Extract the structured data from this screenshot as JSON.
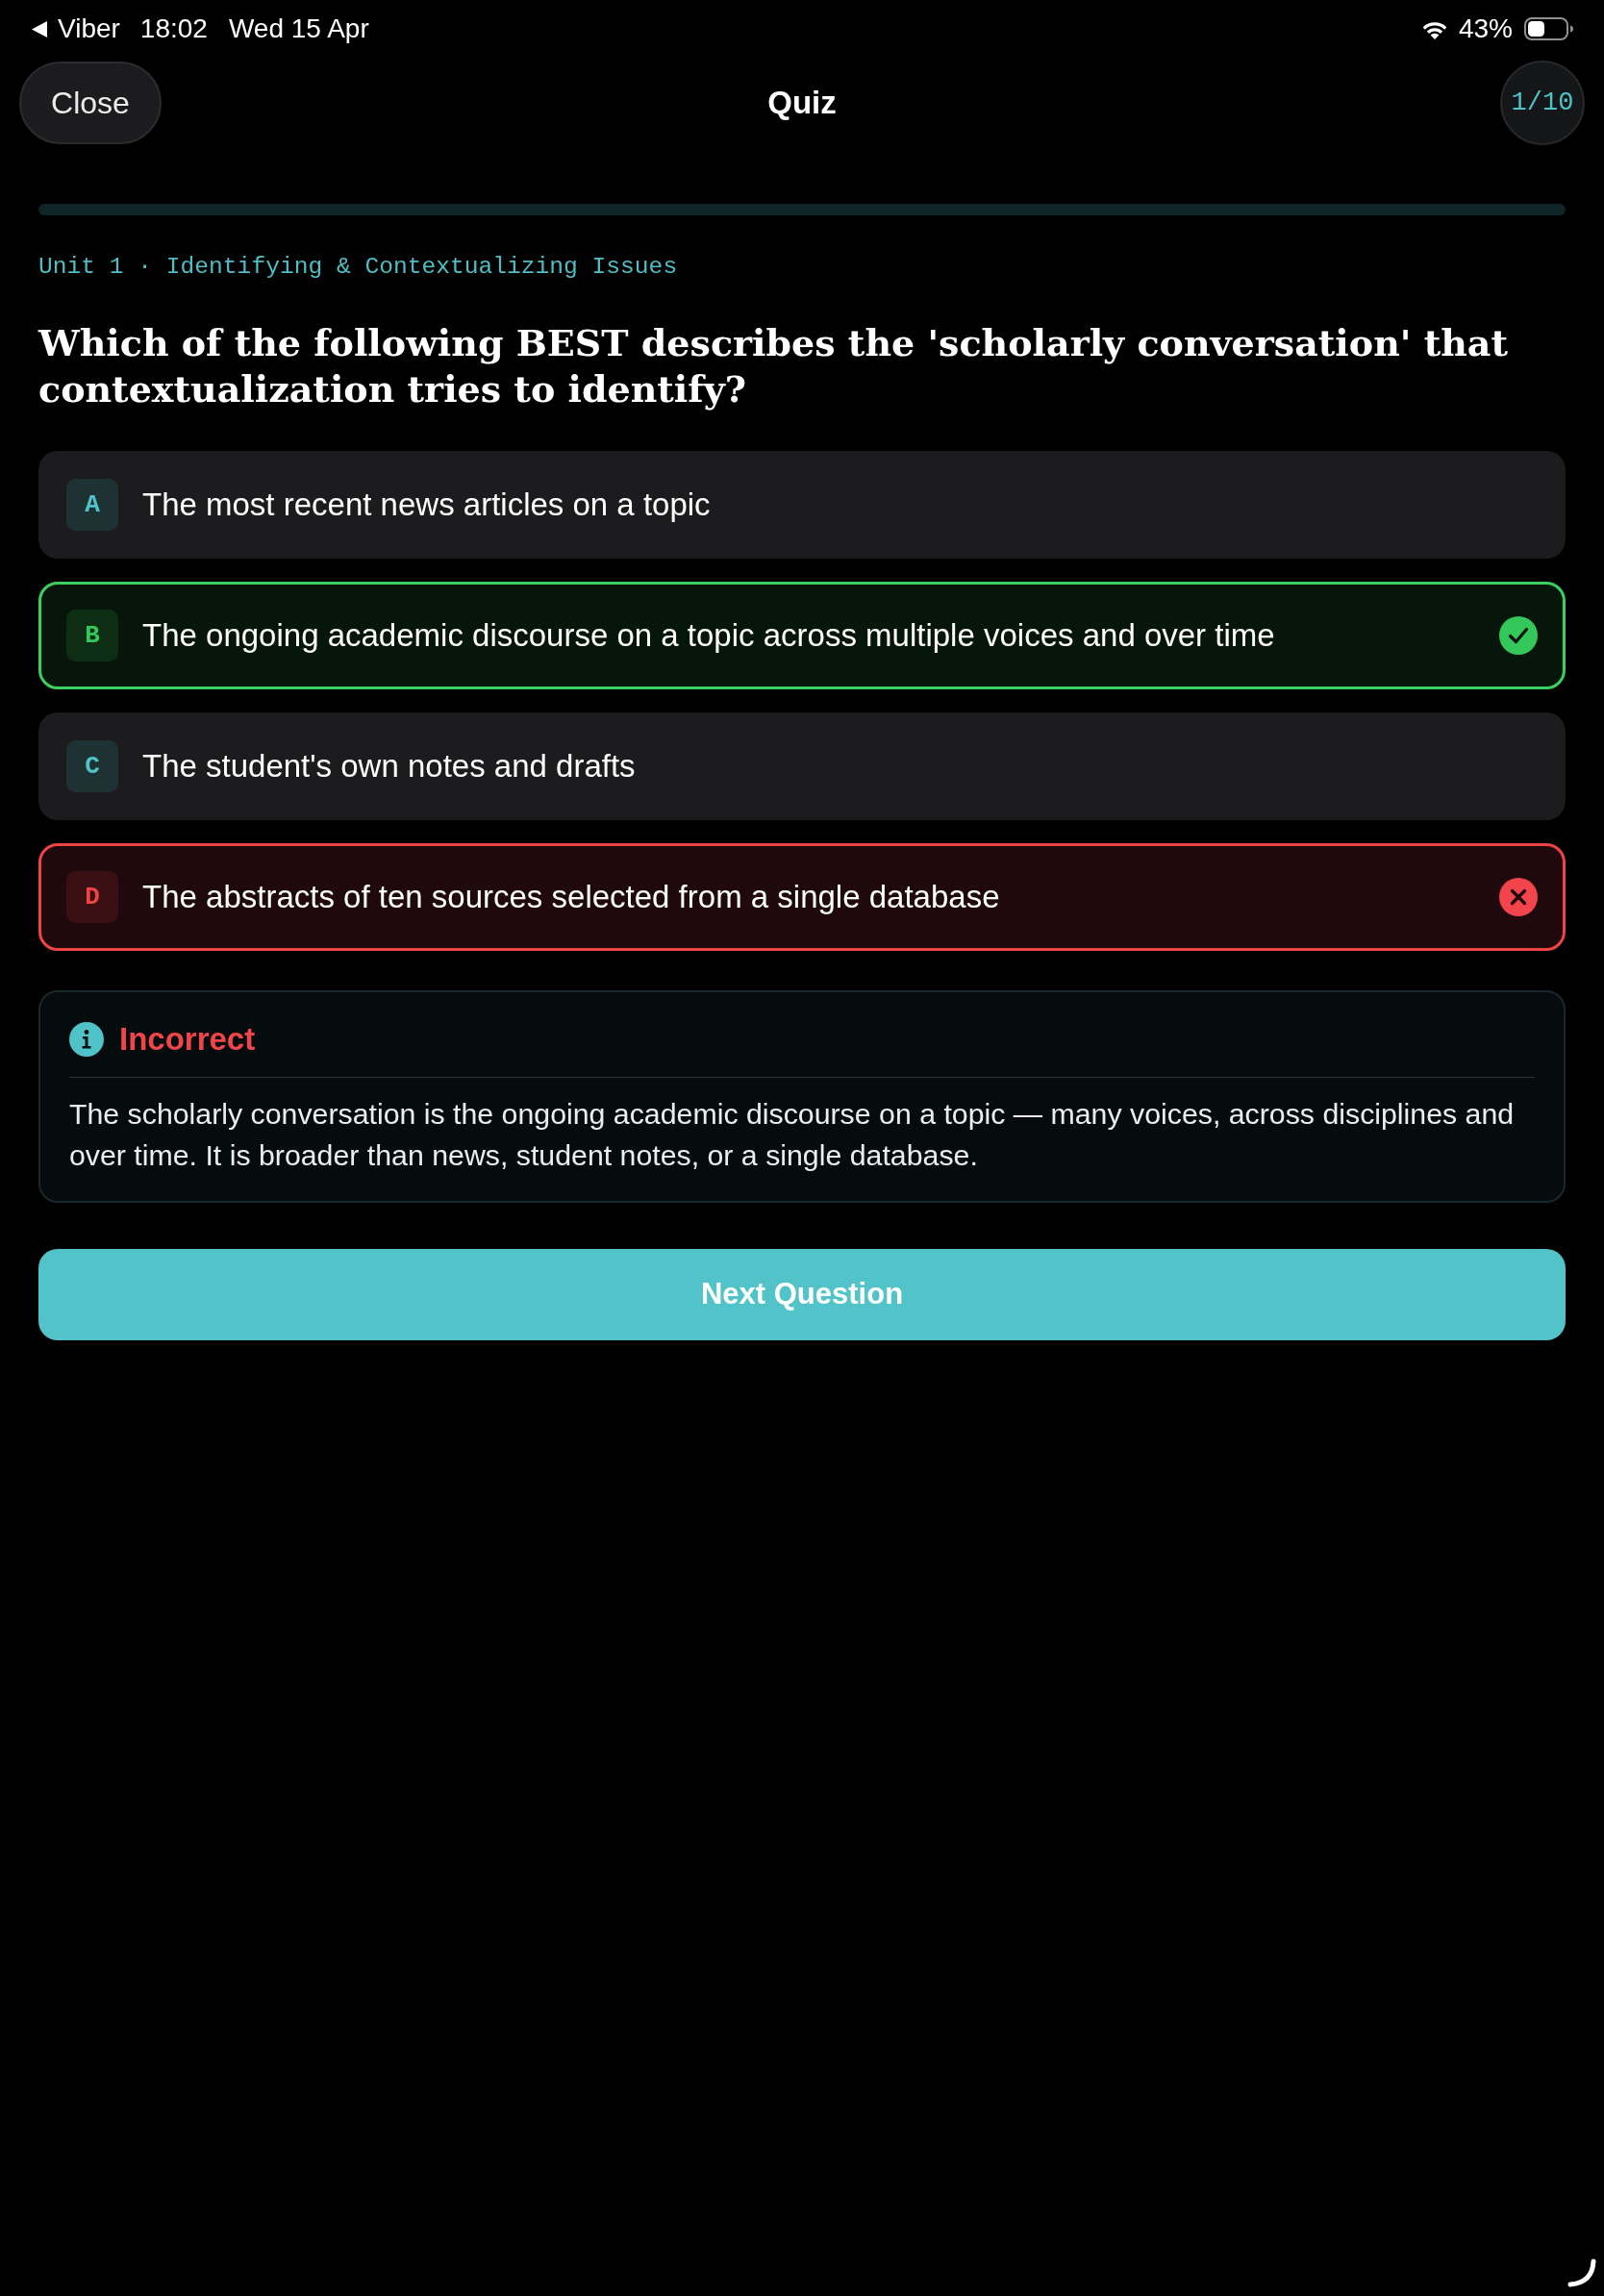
{
  "status_bar": {
    "back_app": "Viber",
    "time": "18:02",
    "date": "Wed 15 Apr",
    "battery": "43%"
  },
  "header": {
    "close_button": "Close",
    "title": "Quiz",
    "counter": "1/10"
  },
  "question": {
    "unit": "Unit 1 · Identifying & Contextualizing Issues",
    "text": "Which of the following BEST describes the 'scholarly conversation' that contextualization tries to identify?"
  },
  "options": [
    {
      "letter": "A",
      "text": "The most recent news articles on a topic",
      "selected": false,
      "correct": false
    },
    {
      "letter": "B",
      "text": "The ongoing academic discourse on a topic across multiple voices and over time",
      "selected": false,
      "correct": true
    },
    {
      "letter": "C",
      "text": "The student's own notes and drafts",
      "selected": false,
      "correct": false
    },
    {
      "letter": "D",
      "text": "The abstracts of ten sources selected from a single database",
      "selected": true,
      "correct": false
    }
  ],
  "feedback": {
    "correct": false,
    "title": "Incorrect",
    "text": "The scholarly conversation is the ongoing academic discourse on a topic — many voices, across disciplines and over time. It is broader than news, student notes, or a single database."
  },
  "next_button": "Next Question"
}
